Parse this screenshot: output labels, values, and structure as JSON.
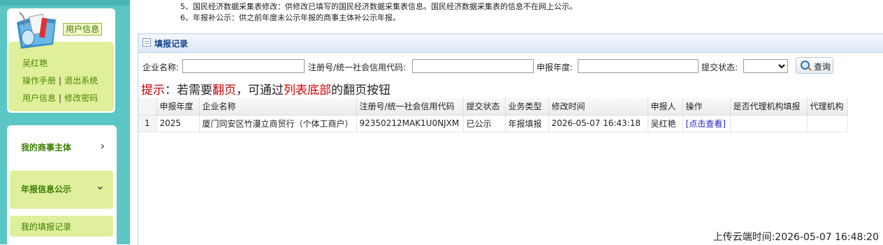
{
  "notes": [
    "5、国民经济数据采集表修改：供修改已填写的国民经济数据采集表信息。国民经济数据采集表的信息不在网上公示。",
    "6、年报补公示：供之前年度未公示年报的商事主体补公示年报。"
  ],
  "sidebar": {
    "user_info_tag": "用户信息",
    "user_name": "吴红艳",
    "manual": "操作手册",
    "logout": "退出系统",
    "user_info_link": "用户信息",
    "change_password": "修改密码",
    "nav": [
      {
        "label": "我的商事主体",
        "chevron": "›"
      },
      {
        "label": "年报信息公示",
        "chevron": "⌄"
      }
    ],
    "sub_item": "我的填报记录"
  },
  "panel": {
    "title": "填报记录"
  },
  "search": {
    "company_label": "企业名称:",
    "company_value": "",
    "reg_label": "注册号/统一社会信用代码:",
    "reg_value": "",
    "year_label": "申报年度:",
    "year_value": "",
    "status_label": "提交状态:",
    "status_value": "",
    "query_label": "查询"
  },
  "tip": {
    "p1": "提示",
    "p2": "：若需要",
    "p3": "翻页",
    "p4": "，可通过",
    "p5": "列表底部",
    "p6": "的翻页按钮"
  },
  "table": {
    "headers": [
      "",
      "申报年度",
      "企业名称",
      "注册号/统一社会信用代码",
      "提交状态",
      "业务类型",
      "修改时间",
      "申报人",
      "操作",
      "是否代理机构填报",
      "代理机构"
    ],
    "rows": [
      [
        "1",
        "2025",
        "厦门同安区竹漫立商贸行（个体工商户）",
        "92350212MAK1U0NJXM",
        "已公示",
        "年报填报",
        "2026-05-07 16:43:18",
        "吴红艳",
        "[点击查看]",
        "",
        ""
      ]
    ]
  },
  "footer": {
    "upload_time": "上传云端时间:2026-05-07 16:48:20"
  }
}
